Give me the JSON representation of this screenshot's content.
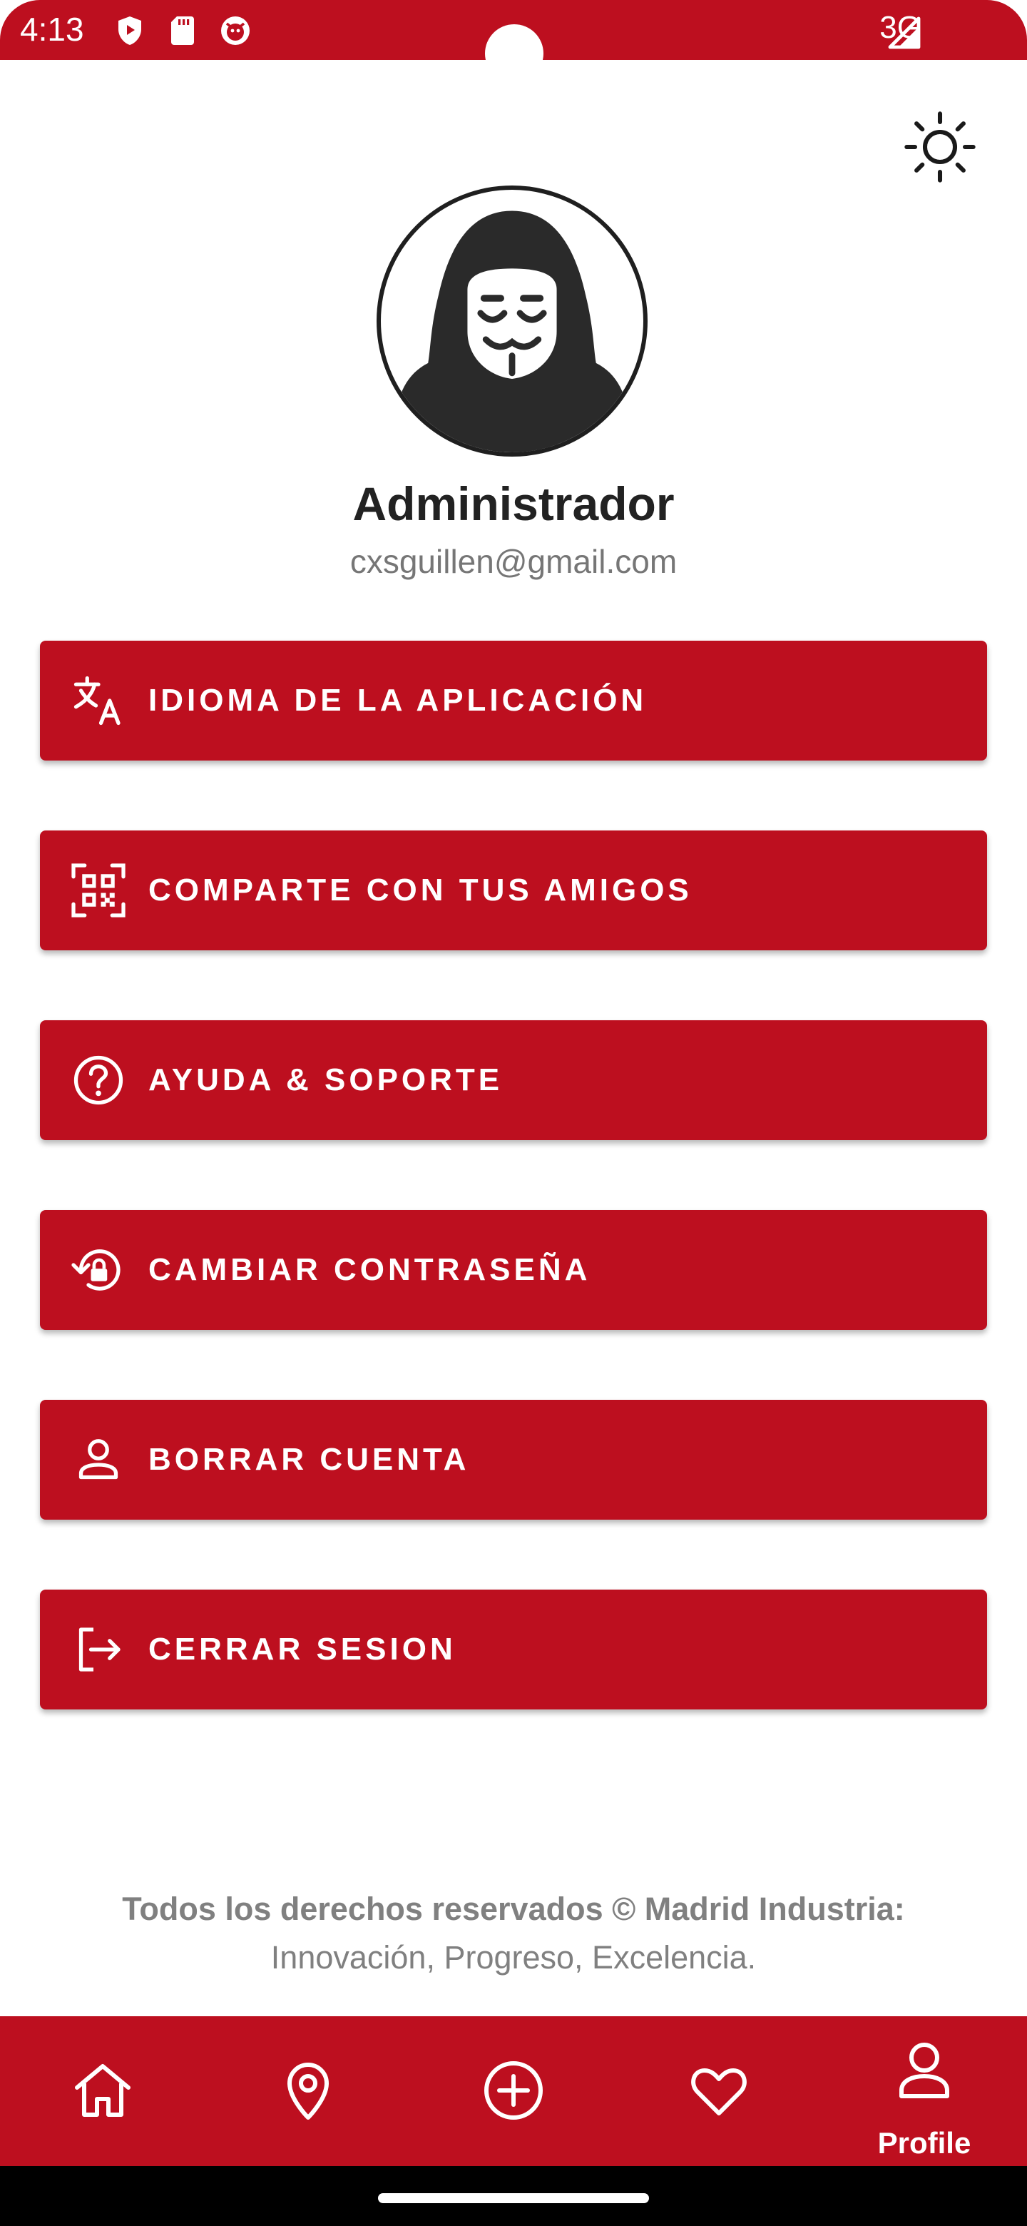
{
  "status_bar": {
    "time": "4:13",
    "network": "3G",
    "icons": [
      "play-protect-icon",
      "sd-card-icon",
      "app-notification-icon",
      "cell-signal-icon"
    ]
  },
  "header": {
    "theme_toggle_icon": "sun-icon"
  },
  "profile": {
    "avatar_icon": "anonymous-hacker-avatar",
    "name": "Administrador",
    "email": "cxsguillen@gmail.com"
  },
  "menu": {
    "items": [
      {
        "label": "IDIOMA DE LA APLICACIÓN",
        "icon": "translate-icon"
      },
      {
        "label": "COMPARTE CON TUS AMIGOS",
        "icon": "qr-code-icon"
      },
      {
        "label": "AYUDA & SOPORTE",
        "icon": "help-icon"
      },
      {
        "label": "CAMBIAR CONTRASEÑA",
        "icon": "lock-reset-icon"
      },
      {
        "label": "BORRAR CUENTA",
        "icon": "person-icon"
      },
      {
        "label": "CERRAR SESION",
        "icon": "logout-icon"
      }
    ]
  },
  "footer": {
    "line1": "Todos los derechos reservados © Madrid Industria:",
    "line2": "Innovación, Progreso, Excelencia."
  },
  "bottom_nav": {
    "items": [
      {
        "icon": "home-icon",
        "label": ""
      },
      {
        "icon": "location-pin-icon",
        "label": ""
      },
      {
        "icon": "add-circle-icon",
        "label": ""
      },
      {
        "icon": "heart-icon",
        "label": ""
      },
      {
        "icon": "profile-icon",
        "label": "Profile",
        "active": true
      }
    ]
  },
  "colors": {
    "brand_red": "#bd0f1f",
    "text_dark": "#222222",
    "text_muted": "#808080"
  }
}
